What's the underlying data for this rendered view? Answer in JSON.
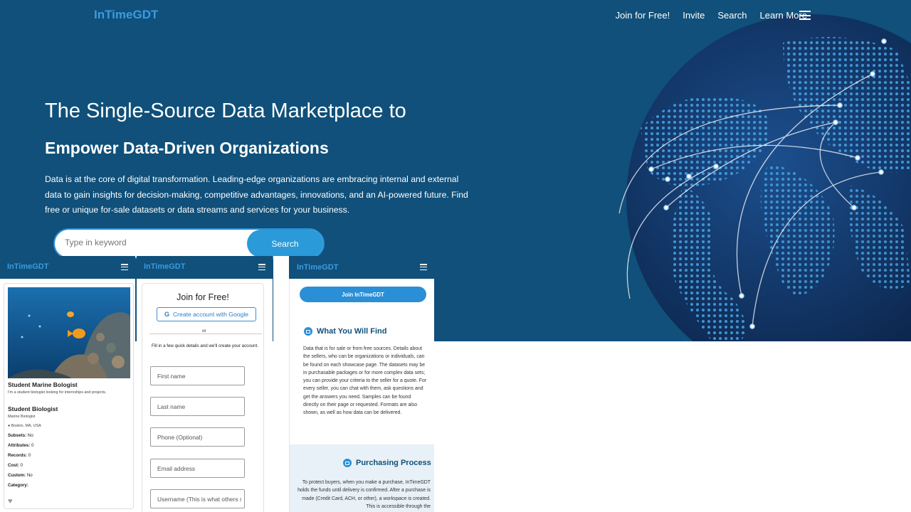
{
  "nav": {
    "brand": "InTimeGDT",
    "links": [
      "Join for Free!",
      "Invite",
      "Search",
      "Learn More"
    ]
  },
  "hero": {
    "headline": "The Single-Source Data Marketplace to",
    "subheadline": "Empower Data-Driven Organizations",
    "description": "Data is at the core of digital transformation. Leading-edge organizations are embracing internal and external data to gain insights for decision-making, competitive advantages, innovations, and an AI-powered future. Find free or unique for-sale datasets or data streams and services for your business.",
    "search_placeholder": "Type in keyword",
    "search_button": "Search"
  },
  "profile_panel": {
    "brand": "InTimeGDT",
    "title": "Student Marine Bologist",
    "subtitle": "I'm a student biologist looking for internships and projects.",
    "name": "Student Biologist",
    "role": "Marine Biologist",
    "location": "Boston, MA, USA",
    "fields": [
      {
        "label": "Subsets:",
        "value": "No"
      },
      {
        "label": "Attributes:",
        "value": "0"
      },
      {
        "label": "Records:",
        "value": "0"
      },
      {
        "label": "Cost:",
        "value": "0"
      },
      {
        "label": "Custom:",
        "value": "No"
      },
      {
        "label": "Category:",
        "value": ""
      }
    ]
  },
  "join_panel": {
    "brand": "InTimeGDT",
    "title": "Join for Free!",
    "google_button": "Create account with Google",
    "or_text": "or",
    "fill_text": "Fill in a few quick details and we'll create your account.",
    "placeholders": [
      "First name",
      "Last name",
      "Phone (Optional)",
      "Email address",
      "Username (This is what others see)"
    ]
  },
  "info_panel": {
    "brand": "InTimeGDT",
    "join_button": "Join InTimeGDT",
    "section1_title": "What You Will  Find",
    "section1_text": "Data that is for sale or from free sources. Details about the sellers, who can be organizations or individuals, can be found on each showcase page.  The datasets may be in purchasable packages or for more complex data sets; you can provide your criteria to the seller for a quote.  For every seller, you can chat with them, ask questions and get the answers you need. Samples can be found directly on their page or requested. Formats are also shown, as well as how data can be delivered.",
    "section2_title": "Purchasing  Process",
    "section2_text": "To protect buyers, when you make a purchase, InTimeGDT holds the funds until delivery is confirmed. After a purchase is made (Credit Card, ACH, or other), a workspace is created. This is accessible through the"
  },
  "colors": {
    "hero_bg": "#10507a",
    "accent": "#2a8fd6",
    "brand_text": "#3a9be0"
  }
}
